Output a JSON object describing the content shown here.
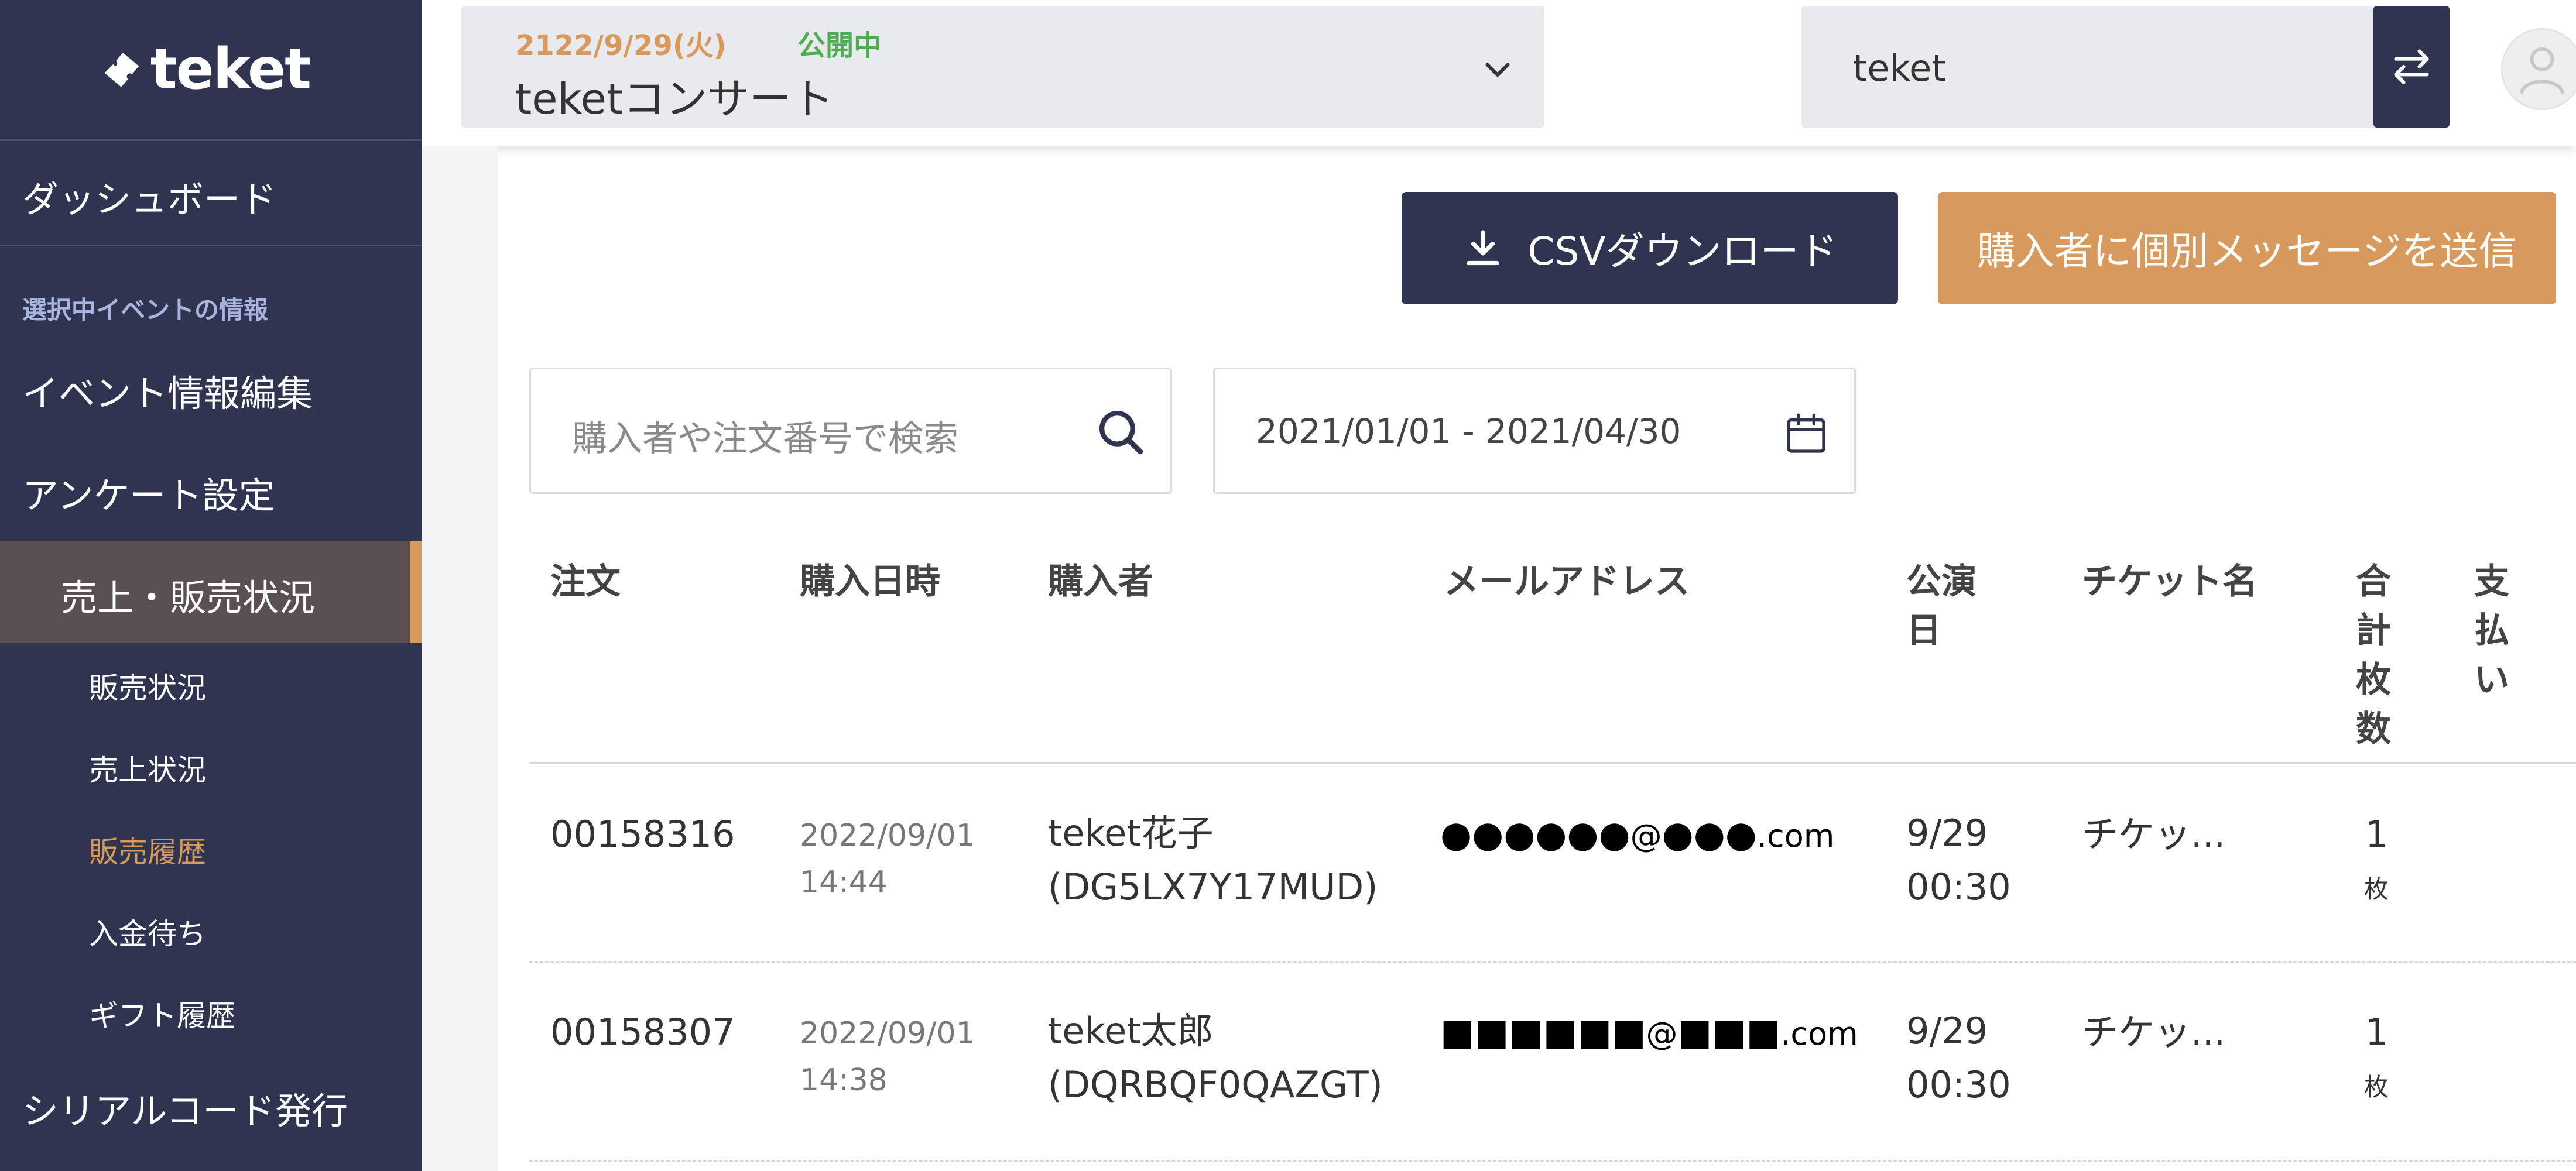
{
  "sidebar": {
    "logo_text": "teket",
    "dashboard": "ダッシュボード",
    "section_caption": "選択中イベントの情報",
    "items": [
      {
        "label": "イベント情報編集"
      },
      {
        "label": "アンケート設定"
      },
      {
        "label": "売上・販売状況"
      },
      {
        "label": "シリアルコード発行"
      }
    ],
    "sub_items": [
      {
        "label": "販売状況"
      },
      {
        "label": "売上状況"
      },
      {
        "label": "販売履歴"
      },
      {
        "label": "入金待ち"
      },
      {
        "label": "ギフト履歴"
      }
    ],
    "current_sub_color": "#d89a5c"
  },
  "header": {
    "event_date": "2122/9/29(火)",
    "event_status": "公開中",
    "event_name": "teketコンサート",
    "organization": "teket"
  },
  "actions": {
    "csv_label": "CSVダウンロード",
    "message_label": "購入者に個別メッセージを送信"
  },
  "filters": {
    "search_placeholder": "購入者や注文番号で検索",
    "date_range": "2021/01/01 - 2021/04/30"
  },
  "table": {
    "headers": {
      "order": "注文",
      "purchase_date": "購入日時",
      "buyer": "購入者",
      "email": "メールアドレス",
      "show_date": [
        "公演",
        "日"
      ],
      "ticket_name": "チケット名",
      "total_count": [
        "合",
        "計",
        "枚",
        "数"
      ],
      "payment": [
        "支",
        "払",
        "い"
      ]
    },
    "rows": [
      {
        "order": "00158316",
        "date": "2022/09/01",
        "time": "14:44",
        "buyer_name": "teket花子",
        "buyer_code": "(DG5LX7Y17MUD)",
        "email_mask": "●●●●●●",
        "email_at": "@",
        "email_domain_mask": "●●●",
        "email_tld": ".com",
        "show_date": "9/29",
        "show_time": "00:30",
        "ticket": "チケッ...",
        "count": "1",
        "unit": "枚"
      },
      {
        "order": "00158307",
        "date": "2022/09/01",
        "time": "14:38",
        "buyer_name": "teket太郎",
        "buyer_code": "(DQRBQF0QAZGT)",
        "email_mask": "■■■■■■",
        "email_at": "@",
        "email_domain_mask": "■■■",
        "email_tld": ".com",
        "show_date": "9/29",
        "show_time": "00:30",
        "ticket": "チケッ...",
        "count": "1",
        "unit": "枚"
      }
    ]
  },
  "colors": {
    "sidebar_bg": "#2f3551",
    "accent_orange": "#d89a5c",
    "status_green": "#4caf50",
    "primary_button": "#2f3551"
  },
  "icons": [
    "teket-logo-icon",
    "chevron-down-icon",
    "switch-arrows-icon",
    "user-icon",
    "download-icon",
    "search-icon",
    "calendar-icon"
  ]
}
